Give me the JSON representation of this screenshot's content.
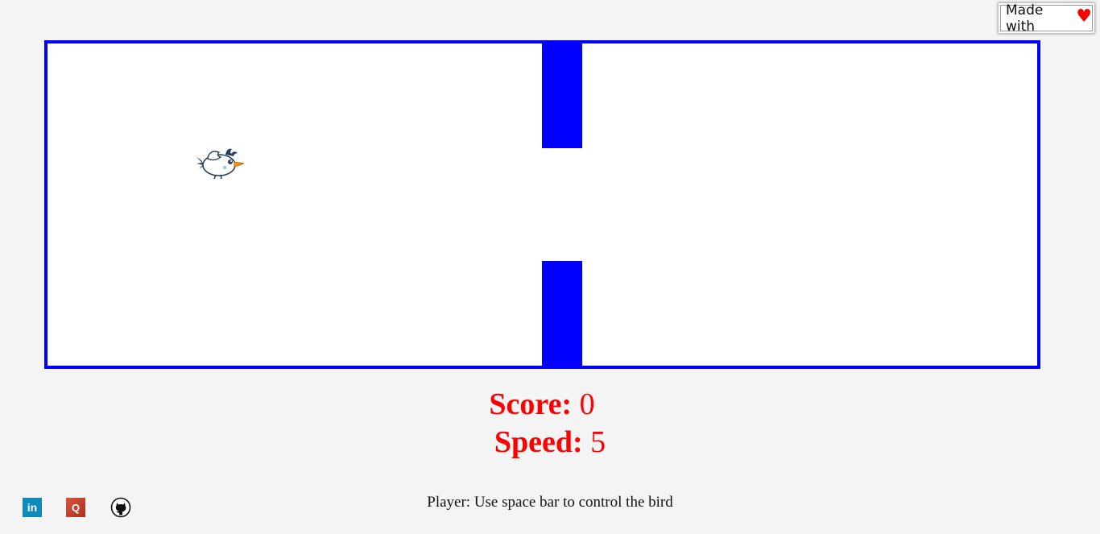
{
  "badge": {
    "text": "Made with",
    "heart": "♥",
    "heart_color": "#ff0000"
  },
  "game": {
    "border_color": "#0000ff",
    "pipe_color": "#0000ff",
    "bird": "bird-sprite"
  },
  "stats": {
    "score_label": "Score:",
    "score_value": "0",
    "speed_label": "Speed:",
    "speed_value": "5",
    "color": "#ff0000"
  },
  "instructions": "Player: Use space bar to control the bird",
  "social": {
    "linkedin_label": "in",
    "quora_label": "Q",
    "github_icon": "github-icon"
  }
}
